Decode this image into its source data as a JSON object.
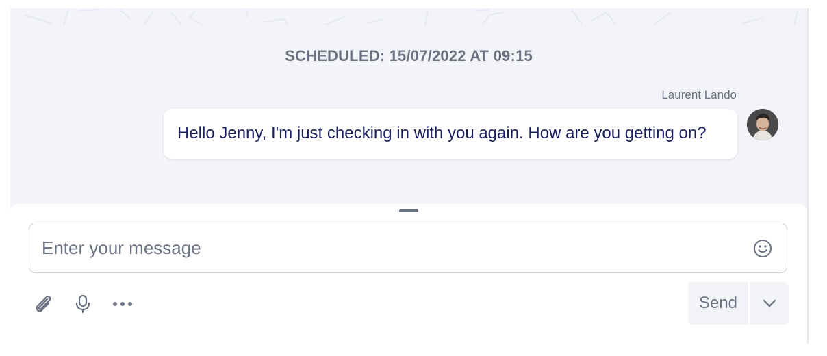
{
  "conversation": {
    "scheduled_label": "SCHEDULED: 15/07/2022 AT 09:15",
    "message": {
      "sender": "Laurent Lando",
      "text": "Hello Jenny, I'm just checking in with you again. How are you getting on?"
    }
  },
  "composer": {
    "placeholder": "Enter your message",
    "send_label": "Send",
    "icons": {
      "emoji": "smiley-icon",
      "attach": "paperclip-icon",
      "voice": "microphone-icon",
      "more": "more-horizontal-icon",
      "send_options": "chevron-down-icon"
    }
  },
  "colors": {
    "panel_background": "#f2f4f9",
    "message_text": "#1b1f60",
    "muted_text": "#6b7283",
    "send_button_bg": "#f2f3f6"
  }
}
